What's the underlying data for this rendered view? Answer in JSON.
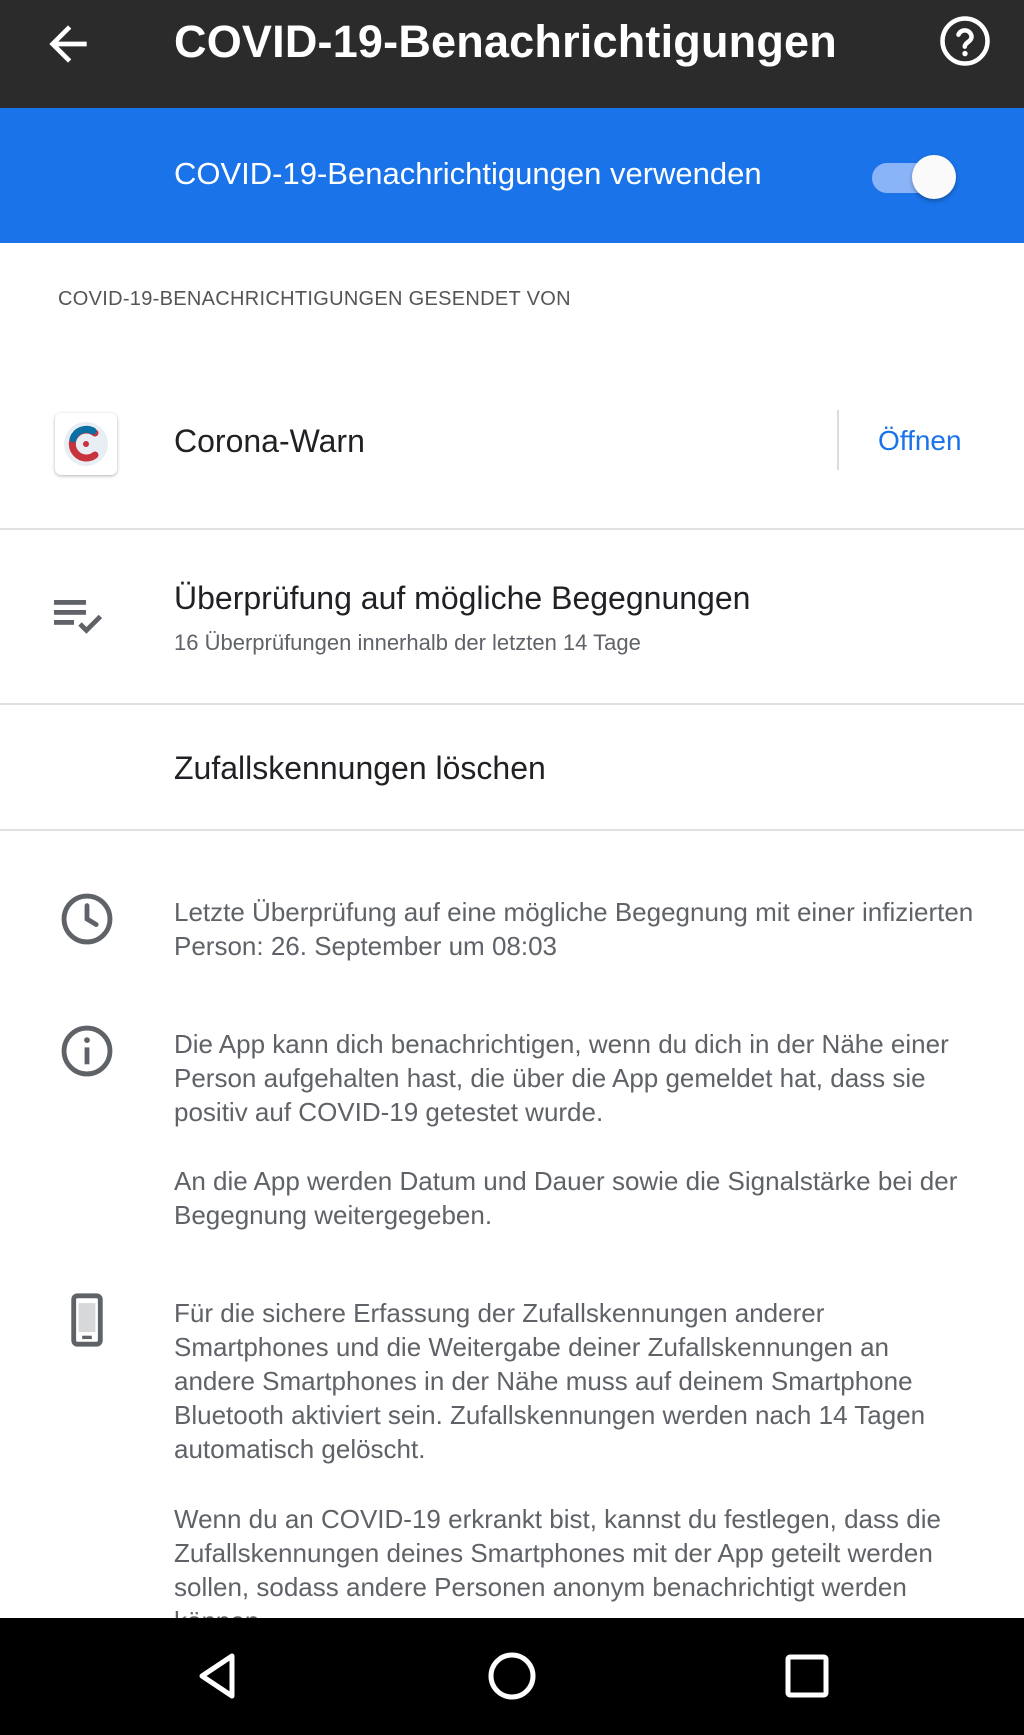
{
  "appbar": {
    "title": "COVID-19-Benachrichtigungen",
    "back_icon": "arrow-back-icon",
    "help_icon": "help-circle-icon"
  },
  "main_toggle": {
    "label": "COVID-19-Benachrichtigungen verwenden",
    "state": "on"
  },
  "sent_by": {
    "header": "COVID-19-BENACHRICHTIGUNGEN GESENDET VON",
    "app_name": "Corona-Warn",
    "open_label": "Öffnen"
  },
  "exposure_checks": {
    "title": "Überprüfung auf mögliche Begegnungen",
    "subtitle": "16 Überprüfungen innerhalb der letzten 14 Tage"
  },
  "delete_ids": {
    "label": "Zufallskennungen löschen"
  },
  "info": {
    "last_check": "Letzte Überprüfung auf eine mögliche Begegnung mit einer infizierten Person: 26. September um 08:03",
    "about_p1": "Die App kann dich benachrichtigen, wenn du dich in der Nähe einer Person aufgehalten hast, die über die App gemeldet hat, dass sie positiv auf COVID-19 getestet wurde.",
    "about_p2": "An die App werden Datum und Dauer sowie die Signalstärke bei der Begegnung weitergegeben.",
    "bluetooth_p1": "Für die sichere Erfassung der Zufallskennungen anderer Smartphones und die Weitergabe deiner Zufallskennungen an andere Smartphones in der Nähe muss auf deinem Smartphone Bluetooth aktiviert sein. Zufallskennungen werden nach 14 Tagen automatisch gelöscht.",
    "bluetooth_p2": "Wenn du an COVID-19 erkrankt bist, kannst du festlegen, dass die Zufallskennungen deines Smartphones mit der App geteilt werden sollen, sodass andere Personen anonym benachrichtigt werden können."
  },
  "colors": {
    "appbar": "#2b2b2b",
    "accent": "#1a73e8",
    "text_primary": "#202124",
    "text_secondary": "#5f6368"
  }
}
